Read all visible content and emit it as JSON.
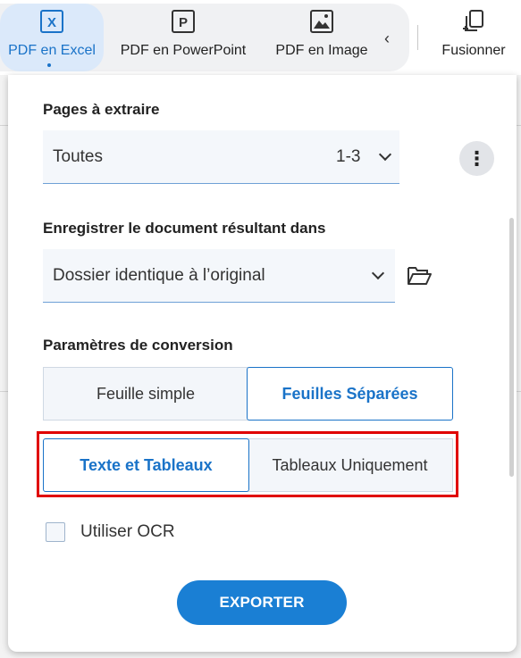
{
  "toolbar": {
    "tools": [
      {
        "label": "PDF en Excel",
        "icon": "excel-icon",
        "glyph": "X",
        "active": true
      },
      {
        "label": "PDF en PowerPoint",
        "icon": "powerpoint-icon",
        "glyph": "P",
        "active": false
      },
      {
        "label": "PDF en Image",
        "icon": "image-icon",
        "active": false
      },
      {
        "label": "Fusionner",
        "icon": "merge-icon",
        "active": false
      }
    ],
    "scroll_left_icon": "chevron-left-icon"
  },
  "pages": {
    "label": "Pages à extraire",
    "selected": "Toutes",
    "range": "1-3"
  },
  "save_location": {
    "label": "Enregistrer le document résultant dans",
    "selected": "Dossier identique à l’original",
    "browse_icon": "folder-open-icon"
  },
  "conversion": {
    "label": "Paramètres de conversion",
    "sheet_mode": {
      "options": [
        "Feuille simple",
        "Feuilles Séparées"
      ],
      "selected": "Feuilles Séparées"
    },
    "content_mode": {
      "options": [
        "Texte et Tableaux",
        "Tableaux Uniquement"
      ],
      "selected": "Texte et Tableaux"
    }
  },
  "ocr": {
    "label": "Utiliser OCR",
    "checked": false
  },
  "export": {
    "label": "EXPORTER"
  },
  "colors": {
    "accent": "#1a73c8",
    "highlight": "#e00000",
    "button": "#1a7fd4"
  }
}
